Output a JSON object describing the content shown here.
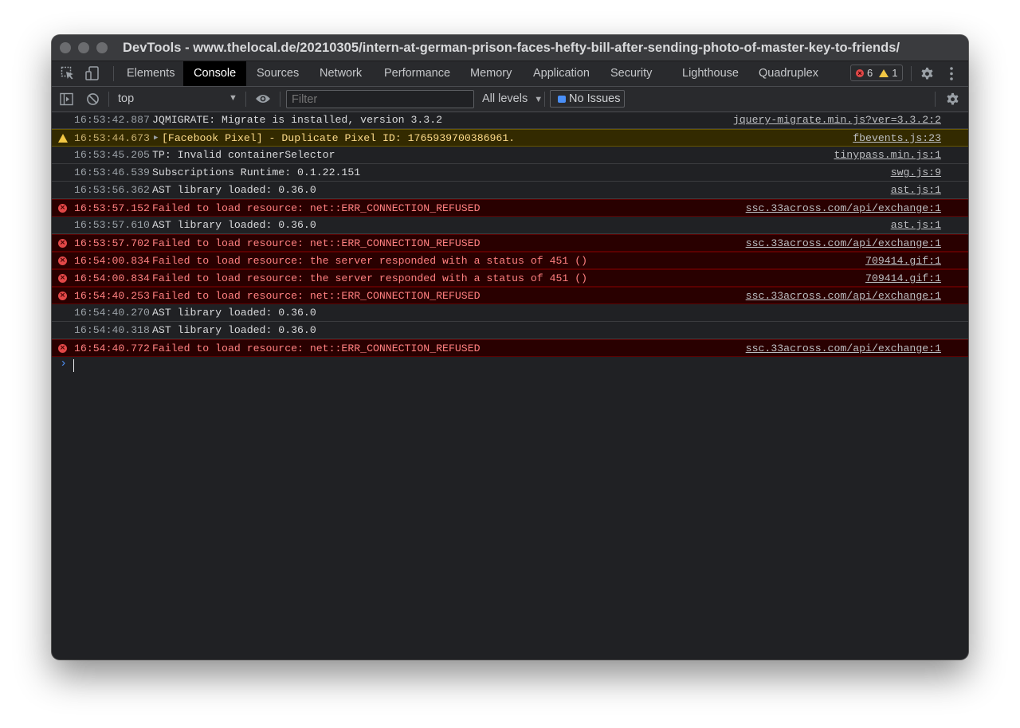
{
  "window": {
    "title": "DevTools - www.thelocal.de/20210305/intern-at-german-prison-faces-hefty-bill-after-sending-photo-of-master-key-to-friends/"
  },
  "tabs": [
    "Elements",
    "Console",
    "Sources",
    "Network",
    "Performance",
    "Memory",
    "Application",
    "Security",
    "Lighthouse",
    "Quadruplex"
  ],
  "active_tab": "Console",
  "counts": {
    "errors": "6",
    "warnings": "1"
  },
  "toolbar": {
    "context": "top",
    "filter_placeholder": "Filter",
    "levels": "All levels",
    "issues": "No Issues"
  },
  "messages": [
    {
      "level": "info",
      "time": "16:53:42.887",
      "text": "JQMIGRATE: Migrate is installed, version 3.3.2",
      "source": "jquery-migrate.min.js?ver=3.3.2:2"
    },
    {
      "level": "warning",
      "time": "16:53:44.673",
      "text": "[Facebook Pixel] - Duplicate Pixel ID: 1765939700386961.",
      "source": "fbevents.js:23"
    },
    {
      "level": "info",
      "time": "16:53:45.205",
      "text": "TP: Invalid containerSelector",
      "source": "tinypass.min.js:1"
    },
    {
      "level": "info",
      "time": "16:53:46.539",
      "text": "Subscriptions Runtime: 0.1.22.151",
      "source": "swg.js:9"
    },
    {
      "level": "info",
      "time": "16:53:56.362",
      "text": "AST library loaded: 0.36.0",
      "source": "ast.js:1"
    },
    {
      "level": "error",
      "time": "16:53:57.152",
      "text": "Failed to load resource: net::ERR_CONNECTION_REFUSED",
      "source": "ssc.33across.com/api/exchange:1"
    },
    {
      "level": "info",
      "time": "16:53:57.610",
      "text": "AST library loaded: 0.36.0",
      "source": "ast.js:1"
    },
    {
      "level": "error",
      "time": "16:53:57.702",
      "text": "Failed to load resource: net::ERR_CONNECTION_REFUSED",
      "source": "ssc.33across.com/api/exchange:1"
    },
    {
      "level": "error",
      "time": "16:54:00.834",
      "text": "Failed to load resource: the server responded with a status of 451 ()",
      "source": "709414.gif:1"
    },
    {
      "level": "error",
      "time": "16:54:00.834",
      "text": "Failed to load resource: the server responded with a status of 451 ()",
      "source": "709414.gif:1"
    },
    {
      "level": "error",
      "time": "16:54:40.253",
      "text": "Failed to load resource: net::ERR_CONNECTION_REFUSED",
      "source": "ssc.33across.com/api/exchange:1"
    },
    {
      "level": "info",
      "time": "16:54:40.270",
      "text": "AST library loaded: 0.36.0",
      "source": ""
    },
    {
      "level": "info",
      "time": "16:54:40.318",
      "text": "AST library loaded: 0.36.0",
      "source": ""
    },
    {
      "level": "error",
      "time": "16:54:40.772",
      "text": "Failed to load resource: net::ERR_CONNECTION_REFUSED",
      "source": "ssc.33across.com/api/exchange:1"
    }
  ],
  "prompt_symbol": "›"
}
